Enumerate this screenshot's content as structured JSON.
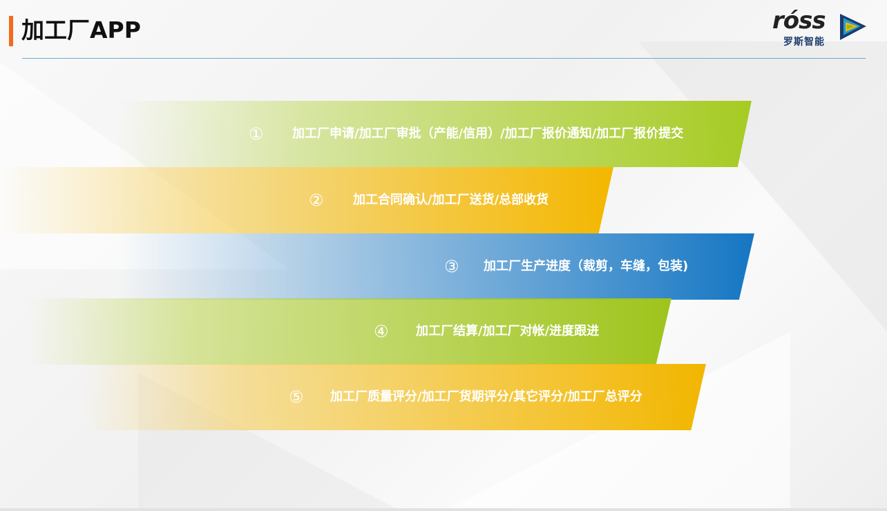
{
  "header": {
    "title": "加工厂APP",
    "accent_color": "#f26b1d",
    "line_color": "#6aa8c9"
  },
  "logo": {
    "wordmark": "róss",
    "subtitle": "罗斯智能",
    "icon": "ross-logo-icon"
  },
  "steps": [
    {
      "number": "①",
      "text": "加工厂申请/加工厂审批（产能/信用）/加工厂报价通知/加工厂报价提交",
      "color": "#a6cb23"
    },
    {
      "number": "②",
      "text": "加工合同确认/加工厂送货/总部收货",
      "color": "#f3b700"
    },
    {
      "number": "③",
      "text": "加工厂生产进度（裁剪，车缝，包装)",
      "color": "#1576c3"
    },
    {
      "number": "④",
      "text": "加工厂结算/加工厂对帐/进度跟进",
      "color": "#9ec41b"
    },
    {
      "number": "⑤",
      "text": "加工厂质量评分/加工厂货期评分/其它评分/加工厂总评分",
      "color": "#f2b600"
    }
  ]
}
